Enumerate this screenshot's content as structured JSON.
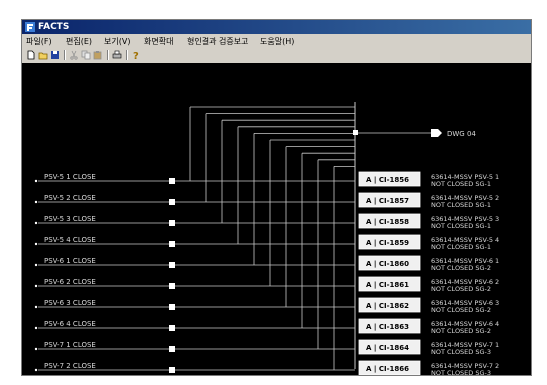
{
  "app": {
    "title": "FACTS"
  },
  "menu": [
    {
      "label": "파일(F)"
    },
    {
      "label": "편집(E)"
    },
    {
      "label": "보기(V)"
    },
    {
      "label": "화면확대"
    },
    {
      "label": "형인결과 검증보고"
    },
    {
      "label": "도움말(H)"
    }
  ],
  "toolbar": {
    "icons": [
      "new-icon",
      "open-icon",
      "save-icon",
      "cut-icon",
      "copy-icon",
      "paste-icon",
      "print-icon",
      "help-icon"
    ]
  },
  "diagram": {
    "output": {
      "label": "DWG 04"
    },
    "rows": [
      {
        "input": "PSV-5 1 CLOSE",
        "tag": "A | CI-1856",
        "desc1": "63614-MSSV PSV-5 1",
        "desc2": "NOT CLOSED SG-1"
      },
      {
        "input": "PSV-5 2 CLOSE",
        "tag": "A | CI-1857",
        "desc1": "63614-MSSV PSV-5 2",
        "desc2": "NOT CLOSED SG-1"
      },
      {
        "input": "PSV-5 3 CLOSE",
        "tag": "A | CI-1858",
        "desc1": "63614-MSSV PSV-5 3",
        "desc2": "NOT CLOSED SG-1"
      },
      {
        "input": "PSV-5 4 CLOSE",
        "tag": "A | CI-1859",
        "desc1": "63614-MSSV PSV-5 4",
        "desc2": "NOT CLOSED SG-1"
      },
      {
        "input": "PSV-6 1 CLOSE",
        "tag": "A | CI-1860",
        "desc1": "63614-MSSV PSV-6 1",
        "desc2": "NOT CLOSED SG-2"
      },
      {
        "input": "PSV-6 2 CLOSE",
        "tag": "A | CI-1861",
        "desc1": "63614-MSSV PSV-6 2",
        "desc2": "NOT CLOSED SG-2"
      },
      {
        "input": "PSV-6 3 CLOSE",
        "tag": "A | CI-1862",
        "desc1": "63614-MSSV PSV-6 3",
        "desc2": "NOT CLOSED SG-2"
      },
      {
        "input": "PSV-6 4 CLOSE",
        "tag": "A | CI-1863",
        "desc1": "63614-MSSV PSV-6 4",
        "desc2": "NOT CLOSED SG-2"
      },
      {
        "input": "PSV-7 1 CLOSE",
        "tag": "A | CI-1864",
        "desc1": "63614-MSSV PSV-7 1",
        "desc2": "NOT CLOSED SG-3"
      },
      {
        "input": "PSV-7 2 CLOSE",
        "tag": "A | CI-1866",
        "desc1": "63614-MSSV PSV-7 2",
        "desc2": "NOT CLOSED SG-3"
      }
    ]
  }
}
